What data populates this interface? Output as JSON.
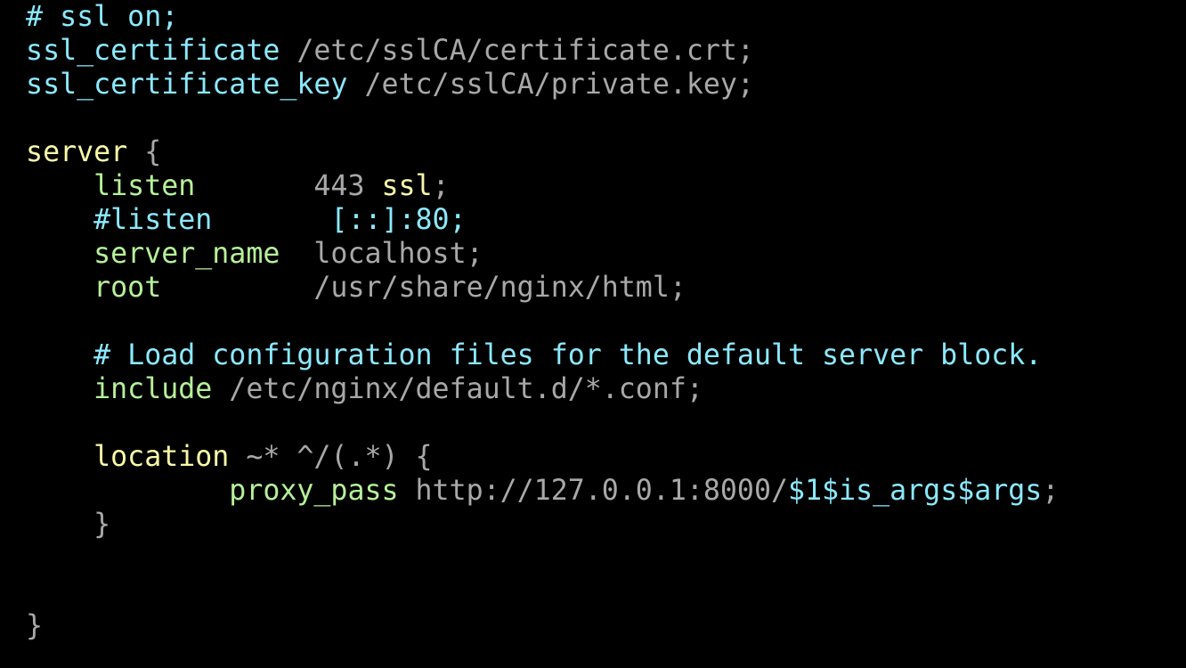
{
  "colors": {
    "background": "#000000",
    "comment": "#8be9fd",
    "directive": "#8be9fd",
    "value": "#a8a8a8",
    "block_keyword": "#f8f8a8",
    "inner_directive": "#b6f09a",
    "variable": "#8be9fd"
  },
  "code": {
    "lines": [
      {
        "tokens": [
          {
            "text": "  # ssl on;",
            "kind": "comment"
          }
        ]
      },
      {
        "tokens": [
          {
            "text": "  ssl_certificate",
            "kind": "directive"
          },
          {
            "text": " /etc/sslCA/certificate.crt;",
            "kind": "value"
          }
        ]
      },
      {
        "tokens": [
          {
            "text": "  ssl_certificate_key",
            "kind": "directive"
          },
          {
            "text": " /etc/sslCA/private.key;",
            "kind": "value"
          }
        ]
      },
      {
        "tokens": [
          {
            "text": "",
            "kind": "value"
          }
        ]
      },
      {
        "tokens": [
          {
            "text": "  server",
            "kind": "block_keyword"
          },
          {
            "text": " {",
            "kind": "value"
          }
        ]
      },
      {
        "tokens": [
          {
            "text": "      listen",
            "kind": "inner_directive"
          },
          {
            "text": "       443 ",
            "kind": "value"
          },
          {
            "text": "ssl",
            "kind": "block_keyword"
          },
          {
            "text": ";",
            "kind": "value"
          }
        ]
      },
      {
        "tokens": [
          {
            "text": "      #listen       [::]:80;",
            "kind": "comment"
          }
        ]
      },
      {
        "tokens": [
          {
            "text": "      server_name",
            "kind": "inner_directive"
          },
          {
            "text": "  localhost;",
            "kind": "value"
          }
        ]
      },
      {
        "tokens": [
          {
            "text": "      root",
            "kind": "inner_directive"
          },
          {
            "text": "         /usr/share/nginx/html;",
            "kind": "value"
          }
        ]
      },
      {
        "tokens": [
          {
            "text": "",
            "kind": "value"
          }
        ]
      },
      {
        "tokens": [
          {
            "text": "      # Load configuration files for the default server block.",
            "kind": "comment"
          }
        ]
      },
      {
        "tokens": [
          {
            "text": "      include",
            "kind": "inner_directive"
          },
          {
            "text": " /etc/nginx/default.d/*.conf;",
            "kind": "value"
          }
        ]
      },
      {
        "tokens": [
          {
            "text": "",
            "kind": "value"
          }
        ]
      },
      {
        "tokens": [
          {
            "text": "      location",
            "kind": "block_keyword"
          },
          {
            "text": " ~* ^/(.*) {",
            "kind": "value"
          }
        ]
      },
      {
        "tokens": [
          {
            "text": "              proxy_pass",
            "kind": "inner_directive"
          },
          {
            "text": " http://127.0.0.1:8000/",
            "kind": "value"
          },
          {
            "text": "$1$is_args$args",
            "kind": "variable"
          },
          {
            "text": ";",
            "kind": "value"
          }
        ]
      },
      {
        "tokens": [
          {
            "text": "      }",
            "kind": "value"
          }
        ]
      },
      {
        "tokens": [
          {
            "text": "",
            "kind": "value"
          }
        ]
      },
      {
        "tokens": [
          {
            "text": "",
            "kind": "value"
          }
        ]
      },
      {
        "tokens": [
          {
            "text": "  }",
            "kind": "value"
          }
        ]
      }
    ]
  }
}
